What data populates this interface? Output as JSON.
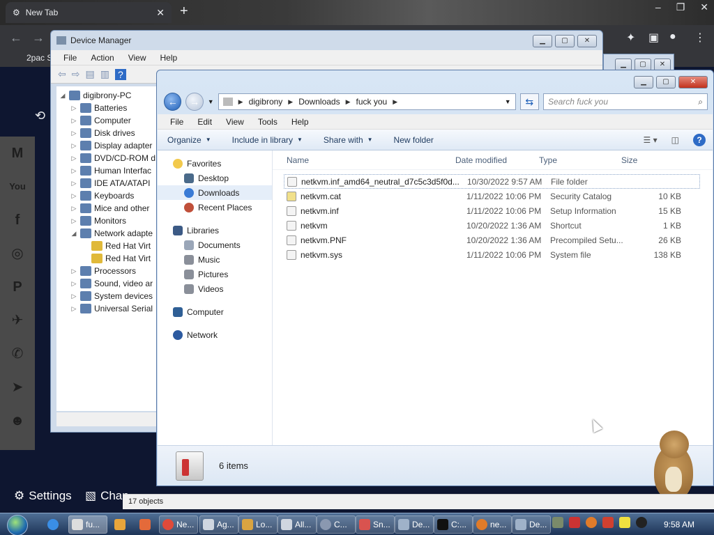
{
  "browser": {
    "tab_title": "New Tab",
    "tab_close": "✕",
    "new_tab": "+",
    "bookmark": "2pac S",
    "settings_label": "Settings",
    "change_label": "Chan"
  },
  "device_manager": {
    "title": "Device Manager",
    "menu": [
      "File",
      "Action",
      "View",
      "Help"
    ],
    "tree": [
      {
        "label": "digibrony-PC",
        "level": 0,
        "arrow": "◢"
      },
      {
        "label": "Batteries",
        "level": 1,
        "arrow": "▷"
      },
      {
        "label": "Computer",
        "level": 1,
        "arrow": "▷"
      },
      {
        "label": "Disk drives",
        "level": 1,
        "arrow": "▷"
      },
      {
        "label": "Display adapter",
        "level": 1,
        "arrow": "▷"
      },
      {
        "label": "DVD/CD-ROM d",
        "level": 1,
        "arrow": "▷"
      },
      {
        "label": "Human Interfac",
        "level": 1,
        "arrow": "▷"
      },
      {
        "label": "IDE ATA/ATAPI",
        "level": 1,
        "arrow": "▷"
      },
      {
        "label": "Keyboards",
        "level": 1,
        "arrow": "▷"
      },
      {
        "label": "Mice and other",
        "level": 1,
        "arrow": "▷"
      },
      {
        "label": "Monitors",
        "level": 1,
        "arrow": "▷"
      },
      {
        "label": "Network adapte",
        "level": 1,
        "arrow": "◢"
      },
      {
        "label": "Red Hat Virt",
        "level": 2,
        "arrow": ""
      },
      {
        "label": "Red Hat Virt",
        "level": 2,
        "arrow": ""
      },
      {
        "label": "Processors",
        "level": 1,
        "arrow": "▷"
      },
      {
        "label": "Sound, video ar",
        "level": 1,
        "arrow": "▷"
      },
      {
        "label": "System devices",
        "level": 1,
        "arrow": "▷"
      },
      {
        "label": "Universal Serial",
        "level": 1,
        "arrow": "▷"
      }
    ]
  },
  "explorer": {
    "breadcrumb": [
      "digibrony",
      "Downloads",
      "fuck you"
    ],
    "search_placeholder": "Search fuck you",
    "menu": [
      "File",
      "Edit",
      "View",
      "Tools",
      "Help"
    ],
    "toolbar": {
      "organize": "Organize",
      "include": "Include in library",
      "share": "Share with",
      "new_folder": "New folder"
    },
    "nav": {
      "favorites": "Favorites",
      "favorites_items": [
        "Desktop",
        "Downloads",
        "Recent Places"
      ],
      "libraries": "Libraries",
      "libraries_items": [
        "Documents",
        "Music",
        "Pictures",
        "Videos"
      ],
      "computer": "Computer",
      "network": "Network"
    },
    "columns": {
      "name": "Name",
      "date": "Date modified",
      "type": "Type",
      "size": "Size"
    },
    "files": [
      {
        "name": "netkvm.inf_amd64_neutral_d7c5c3d5f0d...",
        "date": "10/30/2022 9:57 AM",
        "type": "File folder",
        "size": ""
      },
      {
        "name": "netkvm.cat",
        "date": "1/11/2022 10:06 PM",
        "type": "Security Catalog",
        "size": "10 KB"
      },
      {
        "name": "netkvm.inf",
        "date": "1/11/2022 10:06 PM",
        "type": "Setup Information",
        "size": "15 KB"
      },
      {
        "name": "netkvm",
        "date": "10/20/2022 1:36 AM",
        "type": "Shortcut",
        "size": "1 KB"
      },
      {
        "name": "netkvm.PNF",
        "date": "10/20/2022 1:36 AM",
        "type": "Precompiled Setu...",
        "size": "26 KB"
      },
      {
        "name": "netkvm.sys",
        "date": "1/11/2022 10:06 PM",
        "type": "System file",
        "size": "138 KB"
      }
    ],
    "item_count": "6 items"
  },
  "objects_status": "17 objects",
  "taskbar": {
    "items": [
      "fu...",
      "",
      "",
      "Ne...",
      "Ag...",
      "Lo...",
      "All...",
      "C...",
      "Sn...",
      "De...",
      "C:...",
      "ne...",
      "De..."
    ],
    "clock": "9:58 AM"
  },
  "colors": {
    "accent": "#1e5fb8",
    "taskbar": "#1e3457",
    "selection": "#e5eef9"
  }
}
